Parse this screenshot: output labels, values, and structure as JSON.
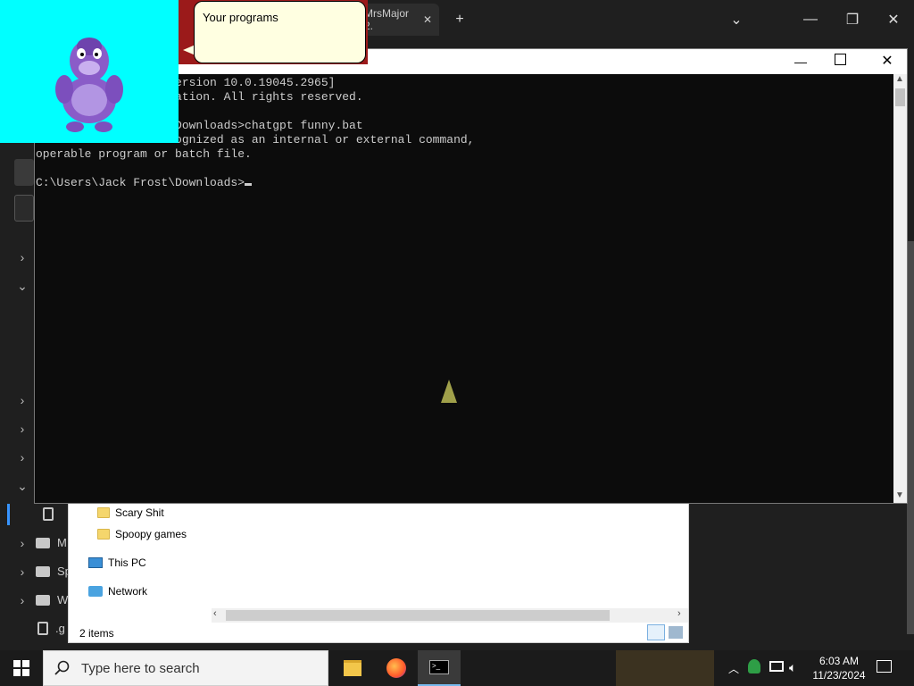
{
  "background_app": {
    "tab_label": "MrsMajor 2.",
    "new_tab": "+",
    "sidebar": {
      "items": [
        {
          "label": "M"
        },
        {
          "label": "Sp"
        },
        {
          "label": "W"
        },
        {
          "label": ".g"
        }
      ]
    }
  },
  "bonzi": {
    "bubble_text": "Your programs"
  },
  "console": {
    "title": "",
    "lines": [
      "                    ersion 10.0.19045.2965]",
      "                    ation. All rights reserved.",
      "",
      "                    Downloads>chatgpt funny.bat",
      "                    ognized as an internal or external command,",
      "operable program or batch file.",
      "",
      "C:\\Users\\Jack Frost\\Downloads>"
    ],
    "fragment_line5": "",
    "cursor": "_"
  },
  "explorer": {
    "folders": [
      {
        "label": "Scary Shit"
      },
      {
        "label": "Spoopy games"
      }
    ],
    "this_pc": "This PC",
    "network": "Network",
    "status": "2 items"
  },
  "taskbar": {
    "search_placeholder": "Type here to search",
    "time": "6:03 AM",
    "date": "11/23/2024"
  }
}
